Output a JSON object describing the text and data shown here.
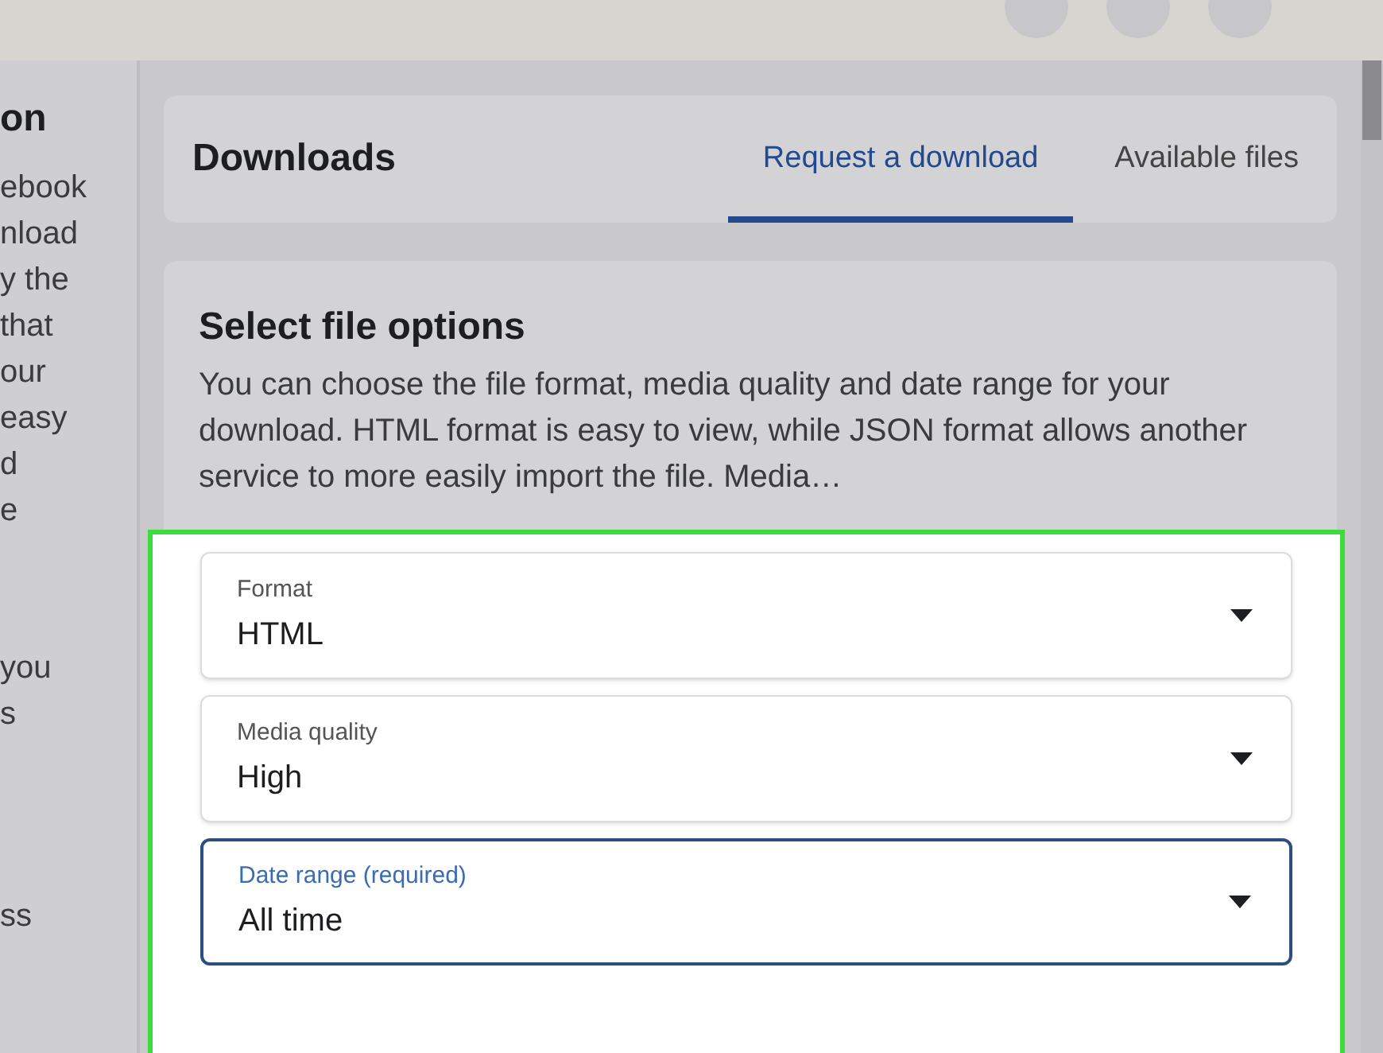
{
  "left_panel": {
    "heading": "on",
    "paragraphs": [
      [
        "ebook",
        "nload",
        "y the",
        "that",
        "our",
        "easy",
        "d",
        "e"
      ],
      [
        "you",
        "s"
      ],
      [
        "ss"
      ]
    ]
  },
  "header": {
    "title": "Downloads",
    "tabs": [
      {
        "label": "Request a download",
        "selected": true
      },
      {
        "label": "Available files",
        "selected": false
      }
    ]
  },
  "options": {
    "title": "Select file options",
    "description": "You can choose the file format, media quality and date range for your download. HTML format is easy to view, while JSON format allows another service to more easily import the file. Media…",
    "fields": [
      {
        "label": "Format",
        "value": "HTML",
        "focused": false
      },
      {
        "label": "Media quality",
        "value": "High",
        "focused": false
      },
      {
        "label": "Date range (required)",
        "value": "All time",
        "focused": true
      }
    ]
  }
}
